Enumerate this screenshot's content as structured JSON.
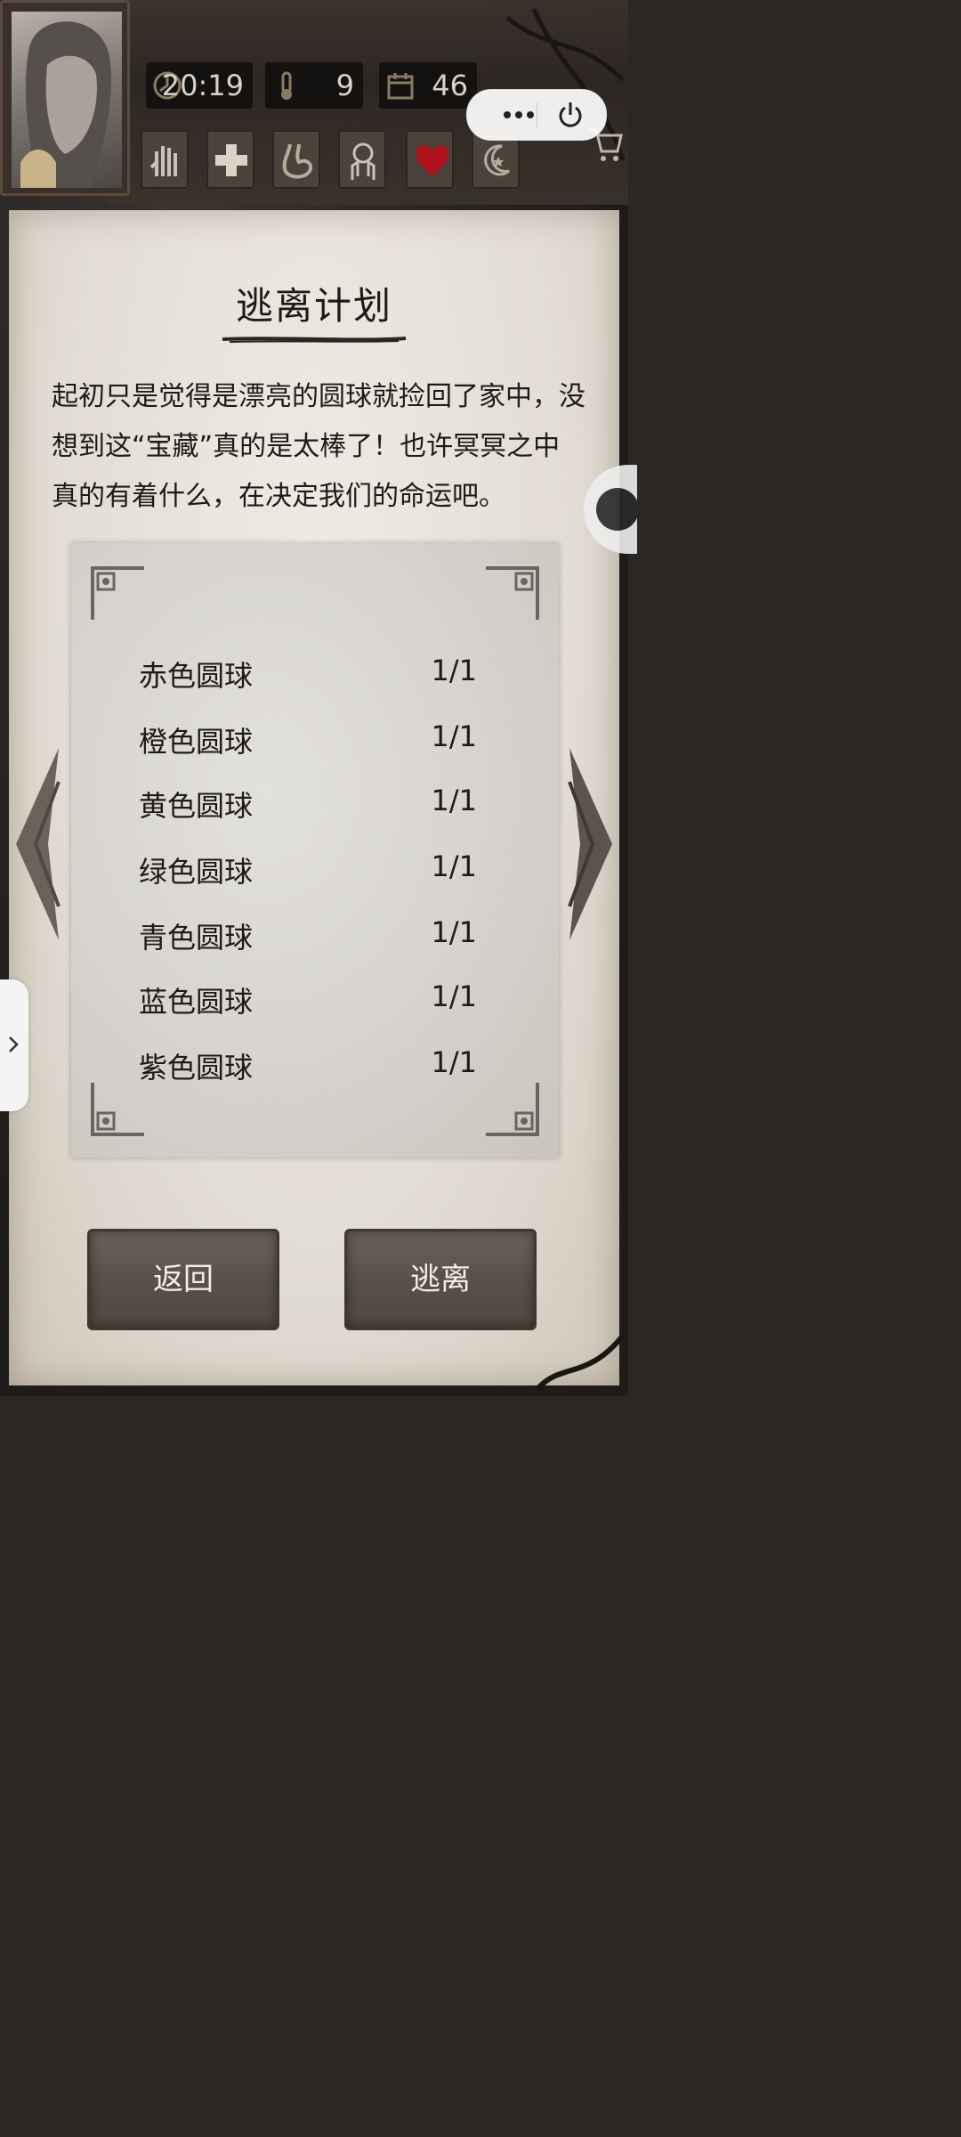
{
  "hud": {
    "time": "20:19",
    "temperature": "9",
    "day": "46",
    "skills": [
      "hand-icon",
      "cross-icon",
      "stomach-icon",
      "brain-icon",
      "heart-icon",
      "moon-icon"
    ]
  },
  "panel": {
    "title": "逃离计划",
    "description": "起初只是觉得是漂亮的圆球就捡回了家中，没想到这“宝藏”真的是太棒了！也许冥冥之中真的有着什么，在决定我们的命运吧。",
    "items": [
      {
        "name": "赤色圆球",
        "count": "1/1"
      },
      {
        "name": "橙色圆球",
        "count": "1/1"
      },
      {
        "name": "黄色圆球",
        "count": "1/1"
      },
      {
        "name": "绿色圆球",
        "count": "1/1"
      },
      {
        "name": "青色圆球",
        "count": "1/1"
      },
      {
        "name": "蓝色圆球",
        "count": "1/1"
      },
      {
        "name": "紫色圆球",
        "count": "1/1"
      }
    ]
  },
  "buttons": {
    "back_label": "返回",
    "escape_label": "逃离"
  },
  "colors": {
    "paper": "#e6e1d8",
    "button": "#5a534c",
    "heart": "#b0121b"
  }
}
